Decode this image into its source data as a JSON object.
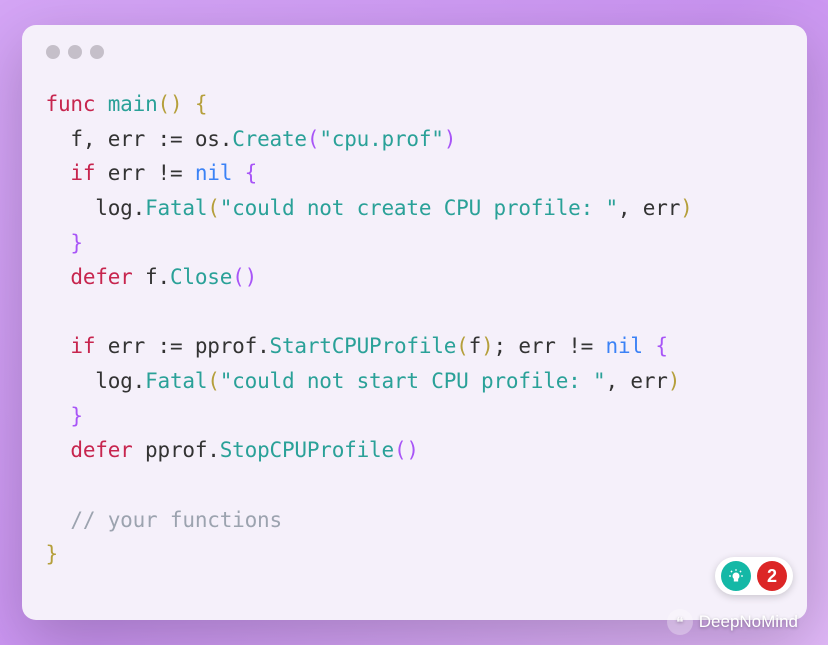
{
  "code": {
    "t_func": "func",
    "t_main": "main",
    "t_parens1": "()",
    "t_lbrace": " {",
    "t_f_err": "  f, err ",
    "t_assign": ":=",
    "t_os": " os",
    "t_dot1": ".",
    "t_create": "Create",
    "t_lparen1": "(",
    "t_str1": "\"cpu.prof\"",
    "t_rparen1": ")",
    "t_if1": "  if",
    "t_errne1": " err != ",
    "t_nil1": "nil",
    "t_lbrace2": " {",
    "t_log1": "    log",
    "t_dot2": ".",
    "t_fatal1": "Fatal",
    "t_lparen2": "(",
    "t_str2": "\"could not create CPU profile: \"",
    "t_comma_err1": ", err",
    "t_rparen2": ")",
    "t_rbrace2": "  }",
    "t_defer1": "  defer",
    "t_fclose": " f",
    "t_dot3": ".",
    "t_close": "Close",
    "t_parens2": "()",
    "t_blank": "",
    "t_if2": "  if",
    "t_err_assign": " err ",
    "t_assign2": ":=",
    "t_pprof1": " pprof",
    "t_dot4": ".",
    "t_startcpu": "StartCPUProfile",
    "t_lparen3": "(",
    "t_f": "f",
    "t_rparen3": ")",
    "t_semi_err": "; err != ",
    "t_nil2": "nil",
    "t_lbrace3": " {",
    "t_log2": "    log",
    "t_dot5": ".",
    "t_fatal2": "Fatal",
    "t_lparen4": "(",
    "t_str3": "\"could not start CPU profile: \"",
    "t_comma_err2": ", err",
    "t_rparen4": ")",
    "t_rbrace3": "  }",
    "t_defer2": "  defer",
    "t_pprof2": " pprof",
    "t_dot6": ".",
    "t_stopcpu": "StopCPUProfile",
    "t_parens3": "()",
    "t_comment": "  // your functions",
    "t_rbrace_end": "}"
  },
  "badge": {
    "count": "2"
  },
  "watermark": {
    "text": "DeepNoMind"
  }
}
